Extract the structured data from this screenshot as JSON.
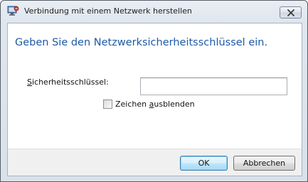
{
  "window": {
    "title": "Verbindung mit einem Netzwerk herstellen",
    "icons": {
      "app": "network-connection-icon",
      "close": "close-x-icon"
    }
  },
  "main": {
    "heading": "Geben Sie den Netzwerksicherheitsschlüssel ein.",
    "key_field": {
      "label_mnemonic": "S",
      "label_rest": "icherheitsschlüssel:",
      "value": "",
      "placeholder": ""
    },
    "hide_chars": {
      "label_before": "Zeichen ",
      "label_mnemonic": "a",
      "label_after": "usblenden",
      "checked": false
    }
  },
  "footer": {
    "ok_label": "OK",
    "cancel_label": "Abbrechen"
  },
  "colors": {
    "heading": "#1d5aa8",
    "frame": "#d9e1ea",
    "ok_button": "#bee6fd"
  }
}
